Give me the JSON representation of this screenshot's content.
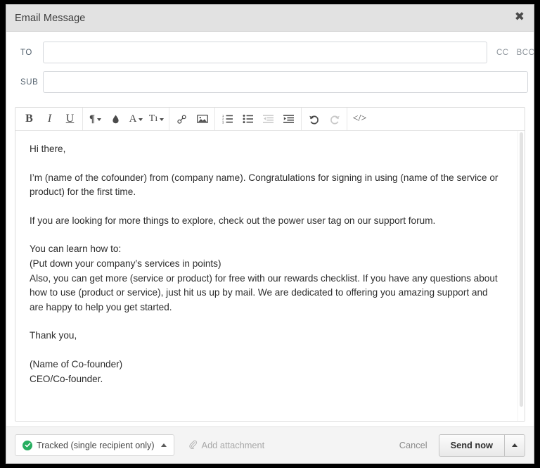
{
  "window": {
    "title": "Email Message",
    "close_icon": "close-icon"
  },
  "fields": {
    "to_label": "TO",
    "to_value": "",
    "to_placeholder": "",
    "sub_label": "SUB",
    "sub_value": "",
    "sub_placeholder": "",
    "cc_label": "CC",
    "bcc_label": "BCC"
  },
  "toolbar": {
    "groups": [
      {
        "buttons": [
          {
            "name": "bold-icon",
            "glyph": "B",
            "style": "gl-b",
            "caret": false,
            "disabled": false
          },
          {
            "name": "italic-icon",
            "glyph": "I",
            "style": "gl-i",
            "caret": false,
            "disabled": false
          },
          {
            "name": "underline-icon",
            "glyph": "U",
            "style": "gl-u",
            "caret": false,
            "disabled": false
          }
        ]
      },
      {
        "buttons": [
          {
            "name": "paragraph-format-icon",
            "glyph": "¶",
            "style": "gl-p",
            "caret": true,
            "disabled": false
          },
          {
            "name": "highlight-color-icon",
            "glyph": "",
            "style": "",
            "caret": false,
            "disabled": false,
            "svg": "droplet"
          },
          {
            "name": "text-color-icon",
            "glyph": "A",
            "style": "gl-a",
            "caret": true,
            "disabled": false
          },
          {
            "name": "font-size-icon",
            "glyph": "Tı",
            "style": "gl-t",
            "caret": true,
            "disabled": false
          }
        ]
      },
      {
        "buttons": [
          {
            "name": "insert-link-icon",
            "glyph": "",
            "style": "",
            "caret": false,
            "disabled": false,
            "svg": "link"
          },
          {
            "name": "insert-image-icon",
            "glyph": "",
            "style": "",
            "caret": false,
            "disabled": false,
            "svg": "image"
          }
        ]
      },
      {
        "buttons": [
          {
            "name": "ordered-list-icon",
            "glyph": "",
            "style": "",
            "caret": false,
            "disabled": false,
            "svg": "ol"
          },
          {
            "name": "bullet-list-icon",
            "glyph": "",
            "style": "",
            "caret": false,
            "disabled": false,
            "svg": "ul"
          },
          {
            "name": "outdent-icon",
            "glyph": "",
            "style": "",
            "caret": false,
            "disabled": true,
            "svg": "outdent"
          },
          {
            "name": "indent-icon",
            "glyph": "",
            "style": "",
            "caret": false,
            "disabled": false,
            "svg": "indent"
          }
        ]
      },
      {
        "buttons": [
          {
            "name": "undo-icon",
            "glyph": "",
            "style": "",
            "caret": false,
            "disabled": false,
            "svg": "undo"
          },
          {
            "name": "redo-icon",
            "glyph": "",
            "style": "",
            "caret": false,
            "disabled": true,
            "svg": "redo"
          }
        ]
      },
      {
        "last": true,
        "buttons": [
          {
            "name": "code-view-icon",
            "glyph": "</>",
            "style": "gl-code",
            "caret": false,
            "disabled": false
          }
        ]
      }
    ]
  },
  "body": {
    "blocks": [
      {
        "lines": [
          "Hi there,"
        ]
      },
      {
        "lines": [
          "I’m (name of the cofounder) from (company name). Congratulations for signing in using (name of the service or product) for the first time."
        ]
      },
      {
        "lines": [
          "If you are looking for more things to explore, check out the power user tag on our support forum."
        ]
      },
      {
        "lines": [
          "You can learn how to:",
          "(Put down your company’s services in points)",
          "Also, you can get more (service or product) for free with our rewards checklist. If you have any questions about how to use (product or service), just hit us up by mail. We are dedicated to offering you amazing support and are happy to help you get started."
        ]
      },
      {
        "lines": [
          "Thank you,"
        ]
      },
      {
        "lines": [
          "(Name of Co-founder)",
          "CEO/Co-founder."
        ]
      }
    ]
  },
  "footer": {
    "tracked_label": "Tracked (single recipient only)",
    "attachment_label": "Add attachment",
    "cancel_label": "Cancel",
    "send_label": "Send now"
  },
  "colors": {
    "titlebar_bg": "#e2e2e2",
    "footer_bg": "#f4f4f4",
    "tracked_green": "#27ae60",
    "text": "#2d2d2d"
  }
}
